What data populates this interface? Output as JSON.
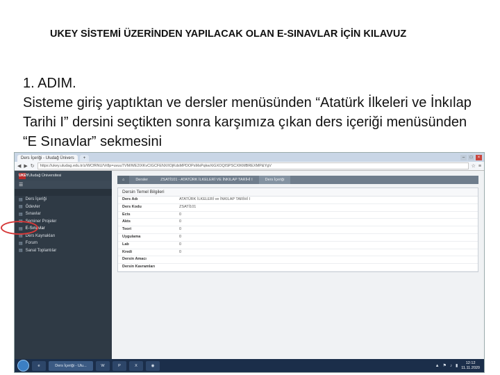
{
  "slide": {
    "title": "UKEY SİSTEMİ ÜZERİNDEN YAPILACAK OLAN E-SINAVLAR İÇİN KILAVUZ",
    "step": "1. ADIM.",
    "body": "Sisteme giriş yaptıktan ve dersler menüsünden “Atatürk İlkeleri ve İnkılap Tarihi I” dersini seçtikten sonra karşımıza çıkan ders içeriği menüsünden “E Sınavlar” sekmesini"
  },
  "browser": {
    "tabs": [
      "Ders İçeriği - Uludağ Ünivers",
      "+"
    ],
    "url": "https://ukey.uludag.edu.tr/z/WCfRNU/Vr8p=uvuuTVM/WE2IXKvCIGCFENX/IOjKdsMPDOPsMsPqkwXiGXOQISPSCXIKMBREXMP&YgV",
    "window_buttons": [
      "–",
      "□",
      "×"
    ]
  },
  "sidebar": {
    "brand_logo": "UKEY",
    "university": "Uludağ Üniversitesi",
    "menu_icon": "☰",
    "items": [
      {
        "label": "Ders İçeriği",
        "icon": "▤"
      },
      {
        "label": "Ödevler",
        "icon": "▤"
      },
      {
        "label": "Sınavlar",
        "icon": "▤"
      },
      {
        "label": "Seminer Projeler",
        "icon": "▤"
      },
      {
        "label": "E-Sınavlar",
        "icon": "▤"
      },
      {
        "label": "Ders Kaynakları",
        "icon": "▤"
      },
      {
        "label": "Forum",
        "icon": "▤"
      },
      {
        "label": "Sanal Toplantılar",
        "icon": "▤"
      }
    ]
  },
  "breadcrumb": {
    "home_icon": "⌂",
    "items": [
      "Dersler",
      "ZSATİ101 - ATATÜRK İLKELERİ VE İNKILAP TARİHİ I",
      "Ders İçeriği"
    ]
  },
  "card": {
    "title": "Dersin Temel Bilgileri",
    "rows": [
      {
        "k": "Ders Adı",
        "v": "ATATÜRK İLKELERİ ve İNKILAP TARİHİ I"
      },
      {
        "k": "Ders Kodu",
        "v": "ZSATİ101"
      },
      {
        "k": "Ects",
        "v": "0"
      },
      {
        "k": "Akts",
        "v": "0"
      },
      {
        "k": "Teori",
        "v": "0"
      },
      {
        "k": "Uygulama",
        "v": "0"
      },
      {
        "k": "Lab",
        "v": "0"
      },
      {
        "k": "Kredi",
        "v": "0"
      },
      {
        "k": "Dersin Amacı",
        "v": ""
      },
      {
        "k": "Dersin Kavramları",
        "v": ""
      }
    ]
  },
  "taskbar": {
    "apps": [
      "e",
      "Ders İçeriği - Ulu...",
      "W",
      "P",
      "X",
      "◉"
    ],
    "tray_icons": [
      "▲",
      "⚑",
      "♪",
      "▮"
    ],
    "time": "12:12",
    "date": "11.11.2020"
  },
  "colors": {
    "highlight_ring": "#d63a3a",
    "sidebar_bg": "#2f3a45"
  }
}
